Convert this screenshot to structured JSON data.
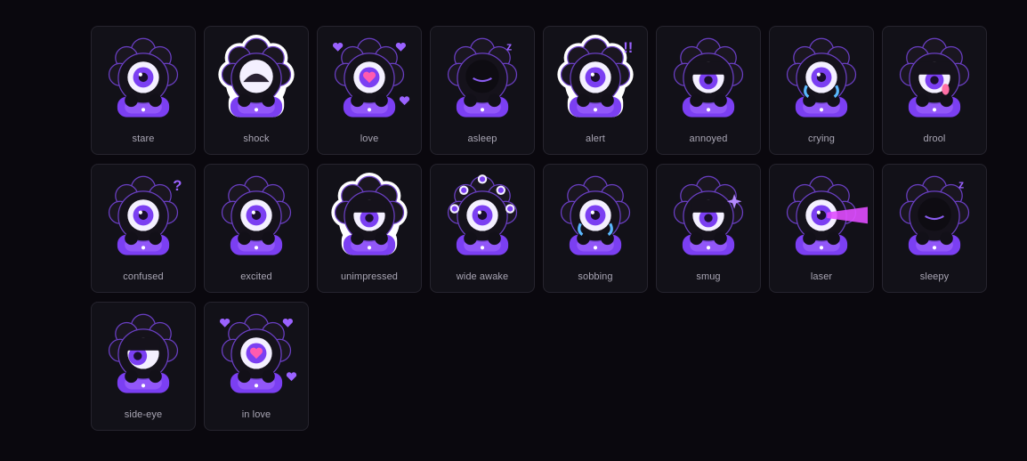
{
  "stickers": [
    {
      "label": "stare",
      "icon": "stare-sticker-icon"
    },
    {
      "label": "shock",
      "icon": "shock-sticker-icon"
    },
    {
      "label": "love",
      "icon": "love-sticker-icon"
    },
    {
      "label": "asleep",
      "icon": "asleep-sticker-icon"
    },
    {
      "label": "alert",
      "icon": "alert-sticker-icon"
    },
    {
      "label": "annoyed",
      "icon": "annoyed-sticker-icon"
    },
    {
      "label": "crying",
      "icon": "crying-sticker-icon"
    },
    {
      "label": "drool",
      "icon": "drool-sticker-icon"
    },
    {
      "label": "confused",
      "icon": "confused-sticker-icon"
    },
    {
      "label": "excited",
      "icon": "excited-sticker-icon"
    },
    {
      "label": "unimpressed",
      "icon": "unimpressed-sticker-icon"
    },
    {
      "label": "wide awake",
      "icon": "wide-awake-sticker-icon"
    },
    {
      "label": "sobbing",
      "icon": "sobbing-sticker-icon"
    },
    {
      "label": "smug",
      "icon": "smug-sticker-icon"
    },
    {
      "label": "laser",
      "icon": "laser-sticker-icon"
    },
    {
      "label": "sleepy",
      "icon": "sleepy-sticker-icon"
    },
    {
      "label": "side-eye",
      "icon": "side-eye-sticker-icon"
    },
    {
      "label": "in love",
      "icon": "in-love-sticker-icon"
    }
  ],
  "colors": {
    "background": "#0a080e",
    "card": "#121118",
    "card_border": "#26242e",
    "label": "#a9a6b4",
    "purple": "#7b3ff2",
    "purple_light": "#a66bff"
  }
}
